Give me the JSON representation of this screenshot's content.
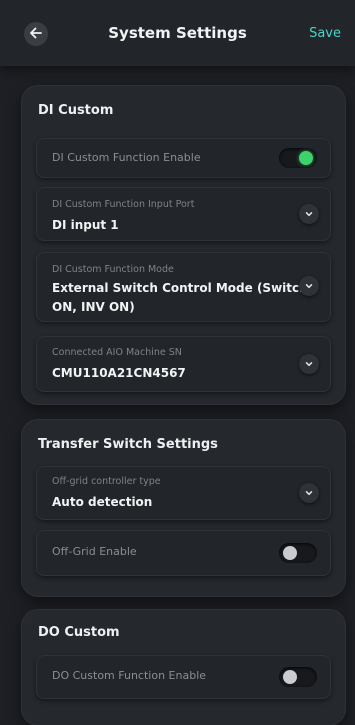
{
  "header": {
    "title": "System Settings",
    "save_label": "Save"
  },
  "di_custom": {
    "title": "DI Custom",
    "function_enable": {
      "label": "DI Custom Function Enable",
      "enabled": true
    },
    "input_port": {
      "label": "DI Custom Function Input Port",
      "value": "DI input 1"
    },
    "mode": {
      "label": "DI Custom Function Mode",
      "value": "External Switch Control Mode (Switch ON, INV ON)"
    },
    "aio_sn": {
      "label": "Connected AIO Machine SN",
      "value": "CMU110A21CN4567"
    }
  },
  "transfer_switch": {
    "title": "Transfer Switch Settings",
    "controller_type": {
      "label": "Off-grid controller type",
      "value": "Auto detection"
    },
    "off_grid_enable": {
      "label": "Off-Grid Enable",
      "enabled": false
    }
  },
  "do_custom": {
    "title": "DO Custom",
    "function_enable": {
      "label": "DO Custom Function Enable",
      "enabled": false
    }
  },
  "colors": {
    "accent": "#49d4c3",
    "toggle_on": "#3fd26b",
    "background": "#1d1f24"
  }
}
